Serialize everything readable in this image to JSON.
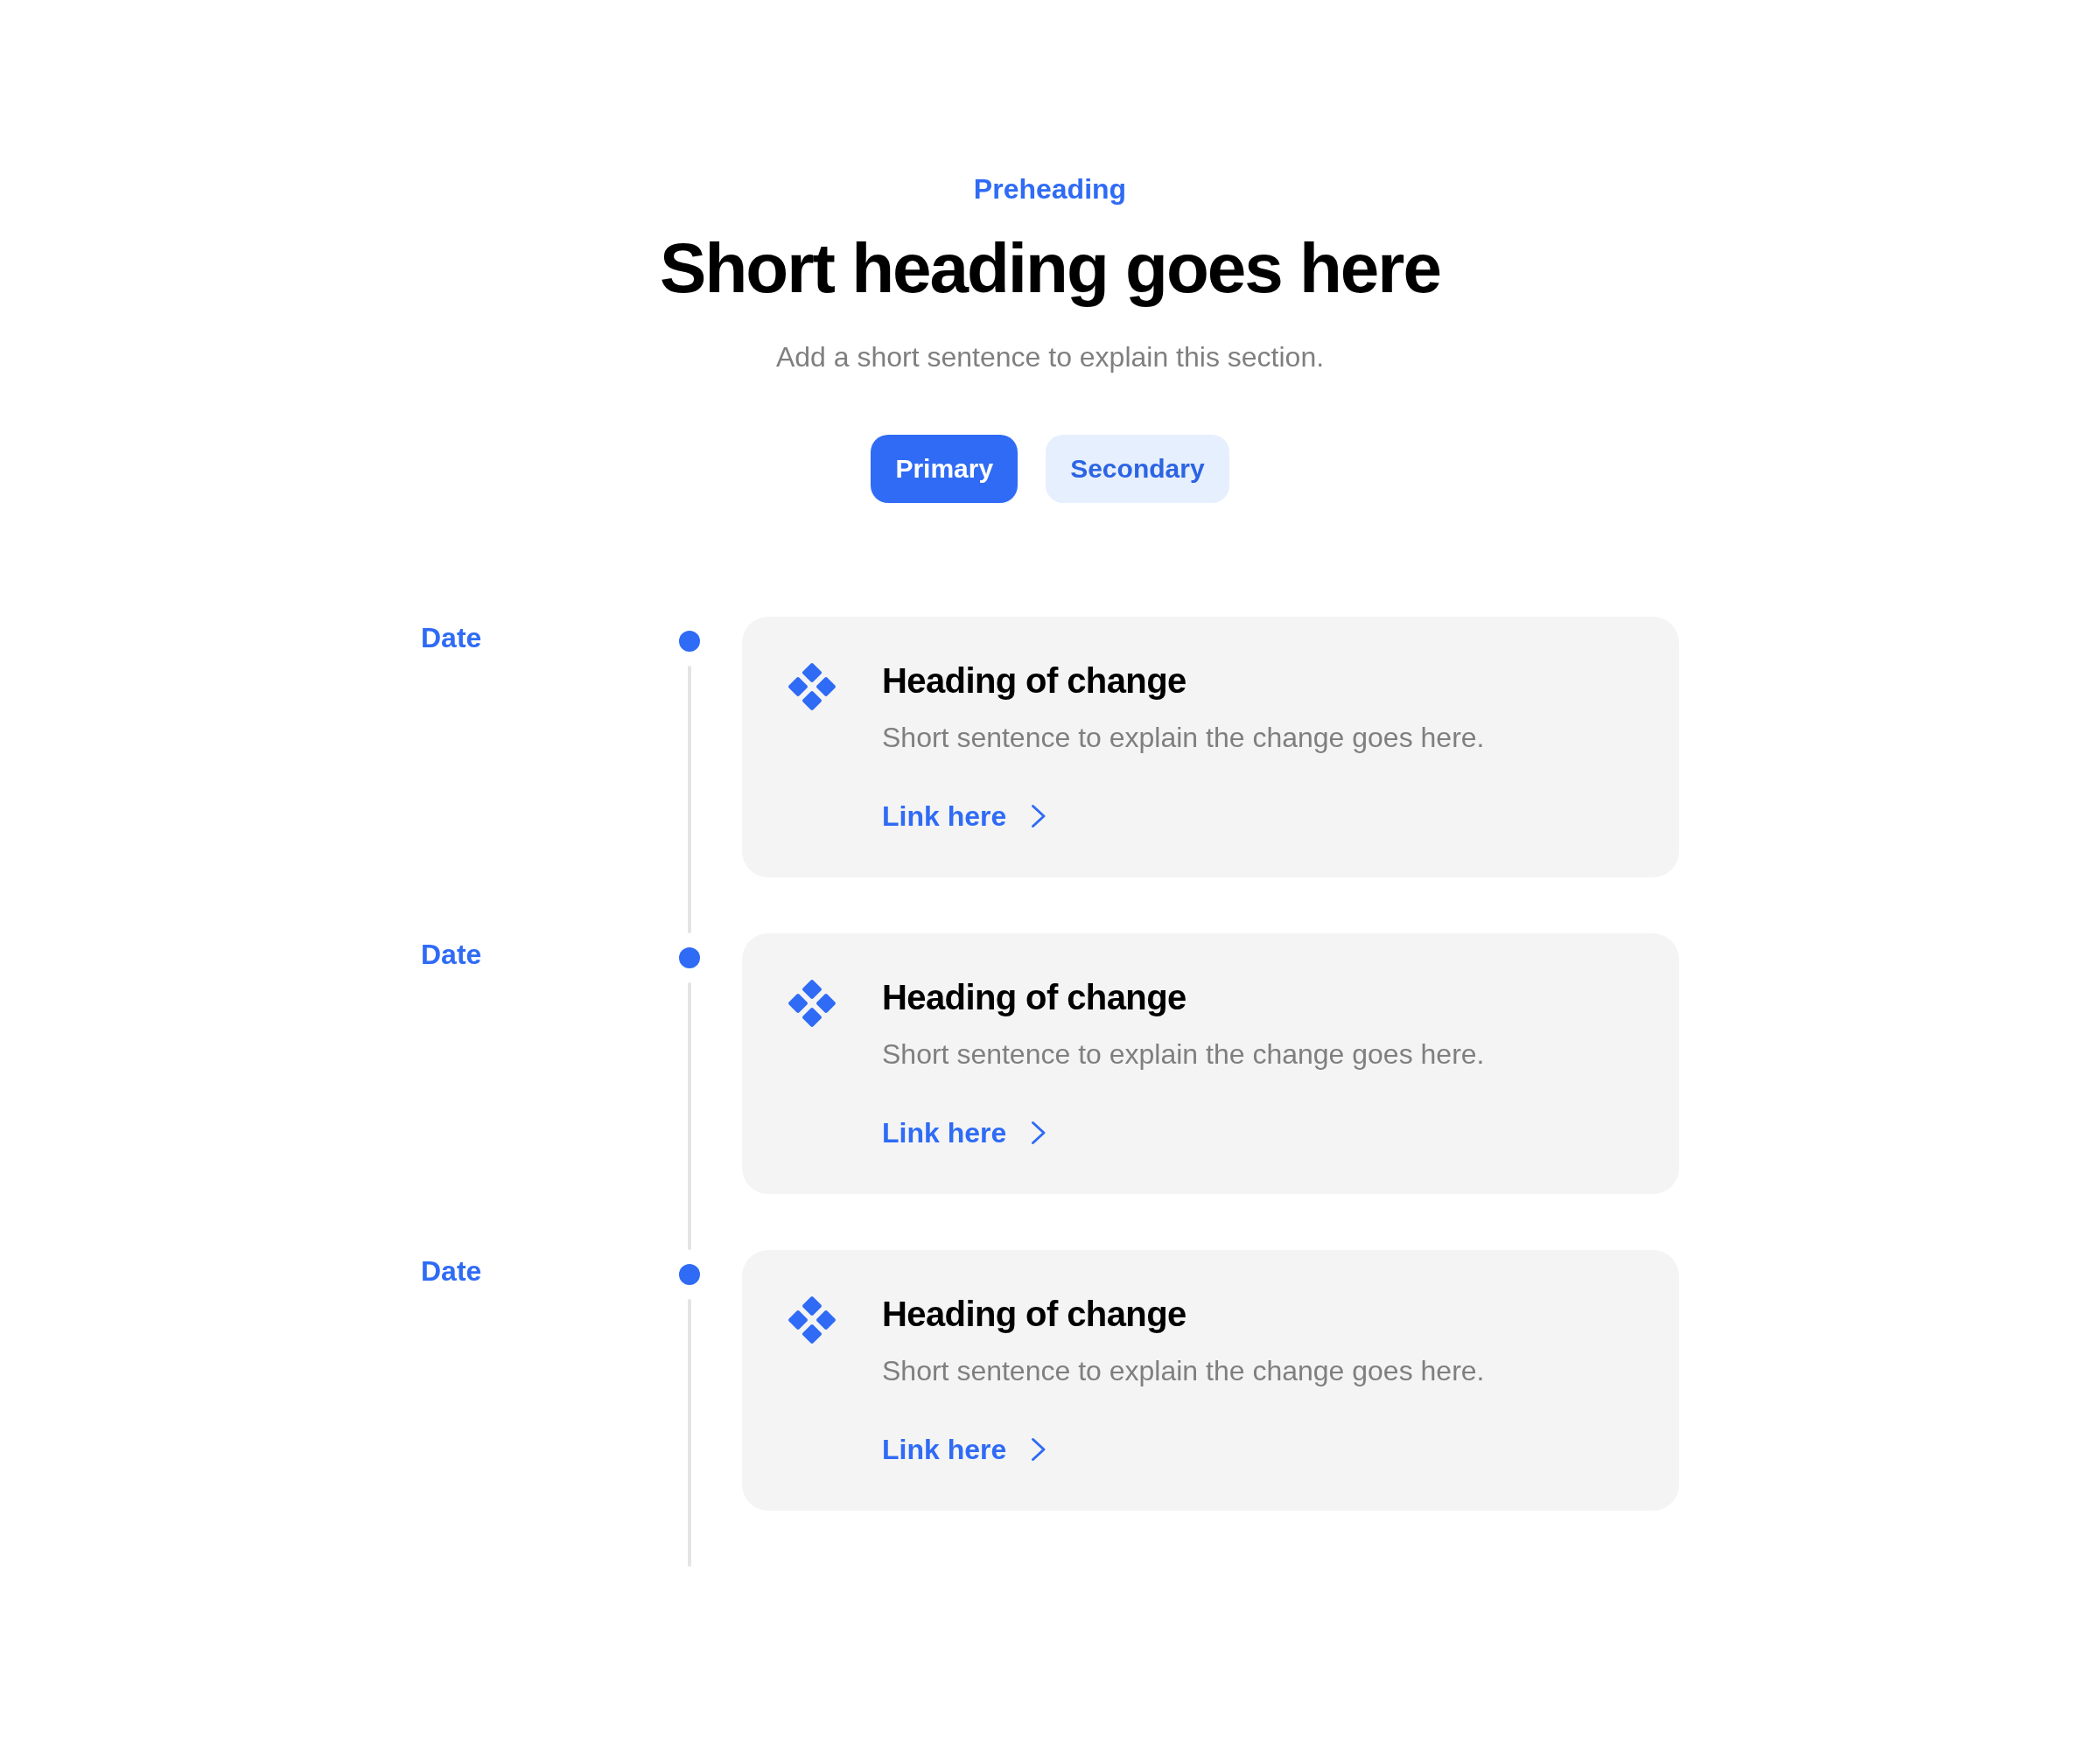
{
  "header": {
    "preheading": "Preheading",
    "heading": "Short heading goes here",
    "subheading": "Add a short sentence to explain this section.",
    "buttons": [
      {
        "label": "Primary",
        "kind": "primary"
      },
      {
        "label": "Secondary",
        "kind": "secondary"
      }
    ]
  },
  "timeline": {
    "entries": [
      {
        "date": "Date",
        "heading": "Heading of change",
        "text": "Short sentence to explain the change goes here.",
        "link": "Link here"
      },
      {
        "date": "Date",
        "heading": "Heading of change",
        "text": "Short sentence to explain the change goes here.",
        "link": "Link here"
      },
      {
        "date": "Date",
        "heading": "Heading of change",
        "text": "Short sentence to explain the change goes here.",
        "link": "Link here"
      }
    ]
  }
}
